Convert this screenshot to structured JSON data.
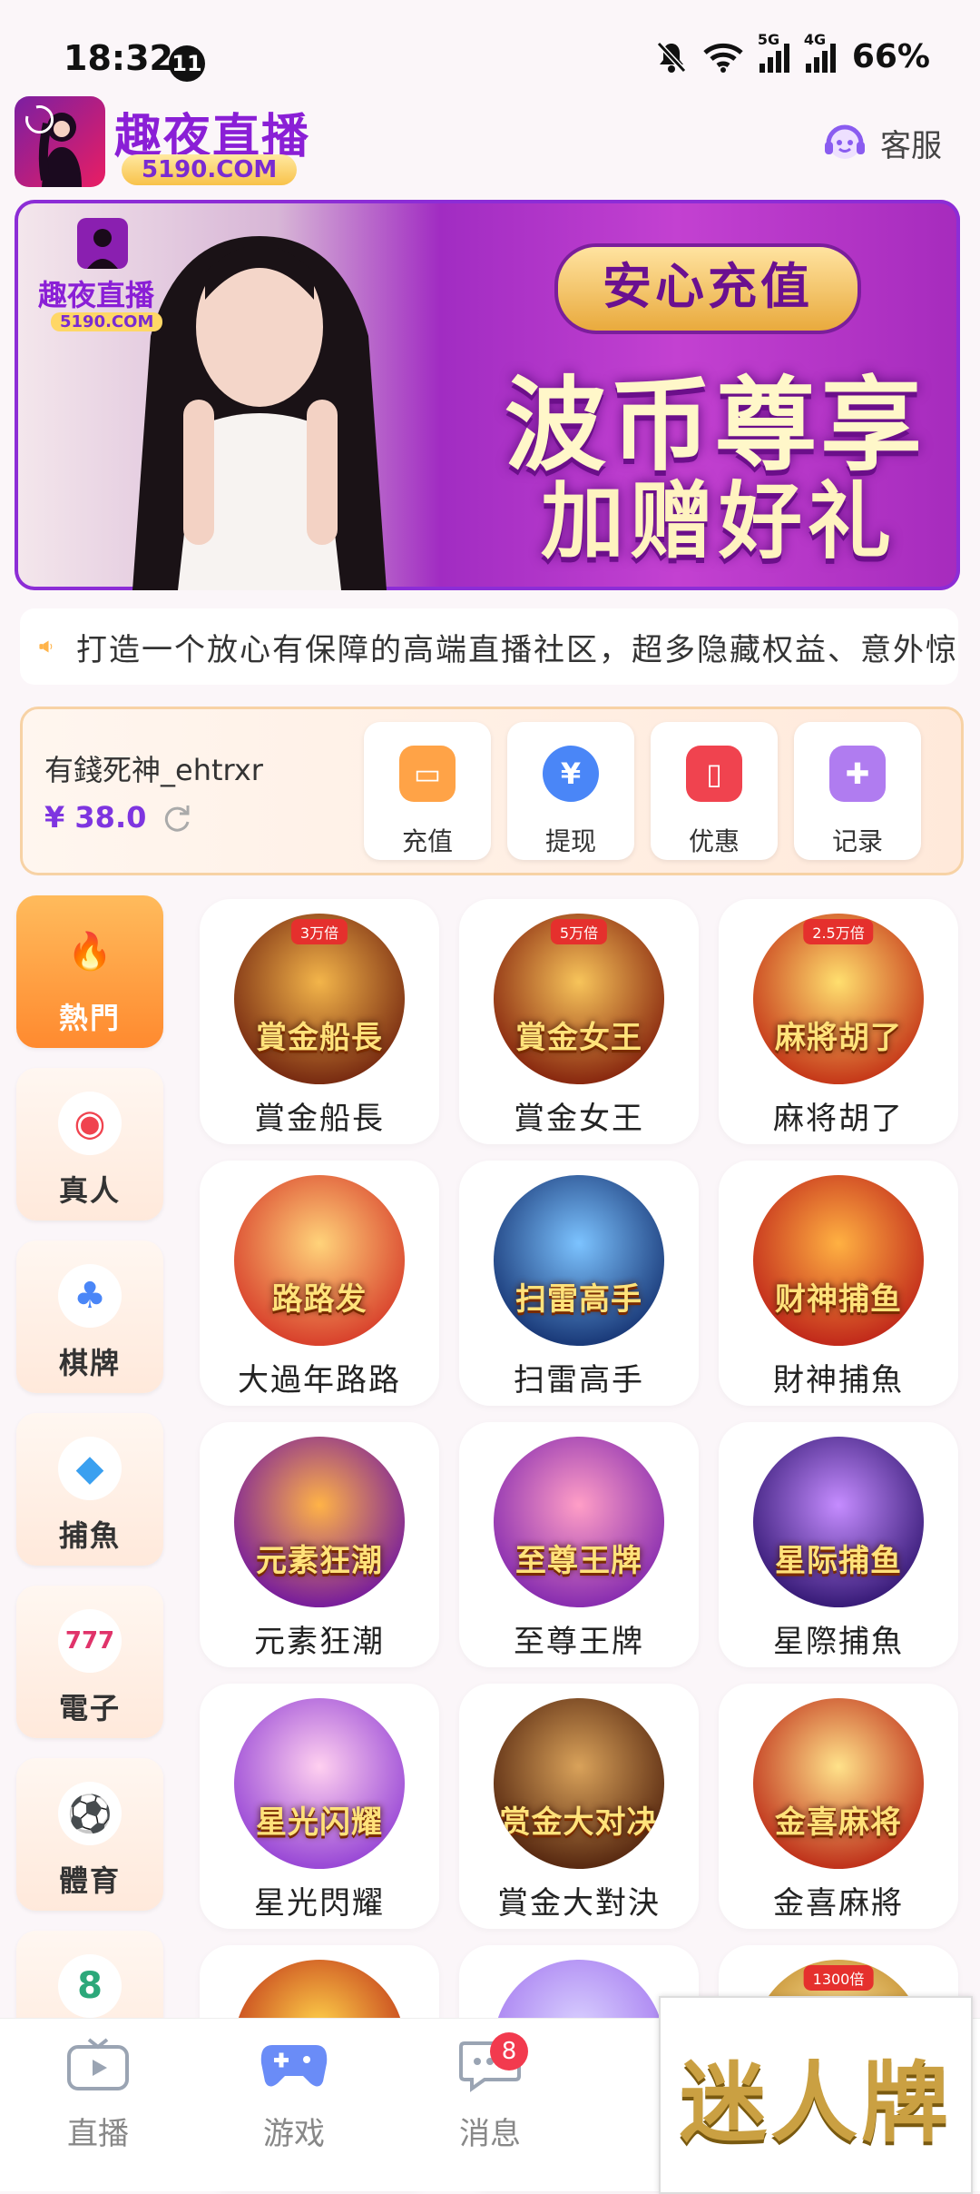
{
  "status": {
    "time": "18:32",
    "notif_count": "11",
    "net1": "5G",
    "net2": "4G",
    "battery": "66%"
  },
  "header": {
    "brand": "趣夜直播",
    "brand_sub": "5190.COM",
    "service_label": "客服"
  },
  "banner": {
    "pill": "安心充值",
    "line1": "波币尊享",
    "line2": "加赠好礼",
    "logo_brand": "趣夜直播",
    "logo_sub": "5190.COM",
    "dot_count": 8,
    "active_dot": 3
  },
  "marquee": {
    "text": "打造一个放心有保障的高端直播社区，超多隐藏权益、意外惊"
  },
  "wallet": {
    "username": "有錢死神_ehtrxr",
    "balance": "¥ 38.0",
    "buttons": [
      {
        "label": "充值",
        "icon": "wallet-icon",
        "color": "#ffa347"
      },
      {
        "label": "提现",
        "icon": "yen-icon",
        "color": "#4a86f7"
      },
      {
        "label": "优惠",
        "icon": "ticket-icon",
        "color": "#f0434f"
      },
      {
        "label": "记录",
        "icon": "gamepad-icon",
        "color": "#b07cf0"
      }
    ]
  },
  "categories": [
    {
      "label": "熱門",
      "icon": "flame-icon"
    },
    {
      "label": "真人",
      "icon": "chip-icon"
    },
    {
      "label": "棋牌",
      "icon": "cards-icon"
    },
    {
      "label": "捕魚",
      "icon": "shark-icon"
    },
    {
      "label": "電子",
      "icon": "slot-777-icon"
    },
    {
      "label": "體育",
      "icon": "soccer-icon"
    },
    {
      "label": "",
      "icon": "billiard-8-icon"
    }
  ],
  "games": [
    {
      "name": "賞金船長",
      "tag": "3万倍",
      "art": "賞金船長",
      "c1": "#f3b54a",
      "c2": "#7a2d12"
    },
    {
      "name": "賞金女王",
      "tag": "5万倍",
      "art": "賞金女王",
      "c1": "#f7c45a",
      "c2": "#8a2a10"
    },
    {
      "name": "麻将胡了",
      "tag": "2.5万倍",
      "art": "麻將胡了",
      "c1": "#ffdf6e",
      "c2": "#c63a1a"
    },
    {
      "name": "大過年路路",
      "tag": "",
      "art": "路路发",
      "c1": "#ffd37a",
      "c2": "#d9432d"
    },
    {
      "name": "扫雷高手",
      "tag": "",
      "art": "扫雷高手",
      "c1": "#7cc3ff",
      "c2": "#1b3b7a"
    },
    {
      "name": "財神捕魚",
      "tag": "",
      "art": "财神捕鱼",
      "c1": "#ffb142",
      "c2": "#c22b1b"
    },
    {
      "name": "元素狂潮",
      "tag": "",
      "art": "元素狂潮",
      "c1": "#ffb347",
      "c2": "#7a1f9a"
    },
    {
      "name": "至尊王牌",
      "tag": "",
      "art": "至尊王牌",
      "c1": "#ff9ec6",
      "c2": "#8a2fb0"
    },
    {
      "name": "星際捕魚",
      "tag": "",
      "art": "星际捕鱼",
      "c1": "#c58cff",
      "c2": "#3a1d7a"
    },
    {
      "name": "星光閃耀",
      "tag": "",
      "art": "星光闪耀",
      "c1": "#ffd0f0",
      "c2": "#9a4ad6"
    },
    {
      "name": "賞金大對決",
      "tag": "",
      "art": "赏金大对决",
      "c1": "#d9a25a",
      "c2": "#5a2b12"
    },
    {
      "name": "金喜麻將",
      "tag": "",
      "art": "金喜麻将",
      "c1": "#ffe28a",
      "c2": "#c0341c"
    },
    {
      "name": "",
      "tag": "",
      "art": "",
      "c1": "#ffd24a",
      "c2": "#c23a1a"
    },
    {
      "name": "",
      "tag": "",
      "art": "",
      "c1": "#d9d0ff",
      "c2": "#a67cf0"
    },
    {
      "name": "",
      "tag": "1300倍",
      "art": "",
      "c1": "#ffe39a",
      "c2": "#c08a2a"
    }
  ],
  "nav": [
    {
      "label": "直播",
      "icon": "tv-icon"
    },
    {
      "label": "游戏",
      "icon": "gamepad-icon"
    },
    {
      "label": "消息",
      "icon": "chat-icon",
      "badge": "8"
    }
  ],
  "promo": {
    "text": "迷人牌"
  }
}
